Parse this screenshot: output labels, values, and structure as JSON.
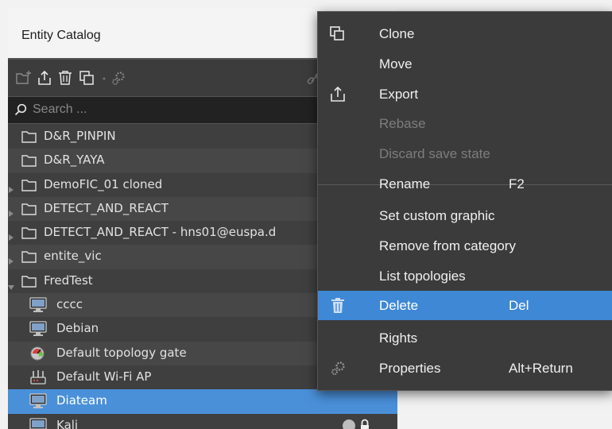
{
  "panel": {
    "title": "Entity Catalog",
    "search_placeholder": "Search ..."
  },
  "toolbar": {
    "icons": [
      "new-folder-icon",
      "export-icon",
      "trash-icon",
      "clone-icon",
      "properties-icon",
      "link-icon"
    ]
  },
  "tree": {
    "rows": [
      {
        "label": "D&R_PINPIN",
        "kind": "folder",
        "expandable": false
      },
      {
        "label": "D&R_YAYA",
        "kind": "folder",
        "expandable": false
      },
      {
        "label": "DemoFIC_01 cloned",
        "kind": "folder",
        "expandable": true
      },
      {
        "label": "DETECT_AND_REACT",
        "kind": "folder",
        "expandable": true
      },
      {
        "label": "DETECT_AND_REACT - hns01@euspa.d",
        "kind": "folder",
        "expandable": true
      },
      {
        "label": "entite_vic",
        "kind": "folder",
        "expandable": true
      },
      {
        "label": "FredTest",
        "kind": "folder",
        "expanded": true
      },
      {
        "label": "cccc",
        "kind": "monitor"
      },
      {
        "label": "Debian",
        "kind": "monitor"
      },
      {
        "label": "Default topology gate",
        "kind": "gateway"
      },
      {
        "label": "Default Wi-Fi AP",
        "kind": "router"
      },
      {
        "label": "Diateam",
        "kind": "monitor",
        "selected": true
      },
      {
        "label": "Kali",
        "kind": "monitor",
        "locked": true
      }
    ]
  },
  "context_menu": {
    "items": [
      {
        "label": "Clone",
        "icon": "clone-icon",
        "enabled": true
      },
      {
        "label": "Move",
        "enabled": true
      },
      {
        "label": "Export",
        "icon": "export-icon",
        "enabled": true
      },
      {
        "label": "Rebase",
        "enabled": false
      },
      {
        "label": "Discard save state",
        "enabled": false
      },
      {
        "label": "Rename",
        "shortcut": "F2",
        "enabled": true
      },
      {
        "label": "Set custom graphic",
        "enabled": true
      },
      {
        "label": "Remove from category",
        "enabled": true
      },
      {
        "label": "List topologies",
        "enabled": true
      },
      {
        "label": "Delete",
        "shortcut": "Del",
        "icon": "trash-icon",
        "enabled": true,
        "highlighted": true
      },
      {
        "label": "Rights",
        "enabled": true
      },
      {
        "label": "Properties",
        "shortcut": "Alt+Return",
        "icon": "gears-icon",
        "enabled": true
      }
    ]
  },
  "colors": {
    "accent": "#4a90d9",
    "menu_highlight": "#3e88d6",
    "panel_bg": "#3f3f3f"
  }
}
